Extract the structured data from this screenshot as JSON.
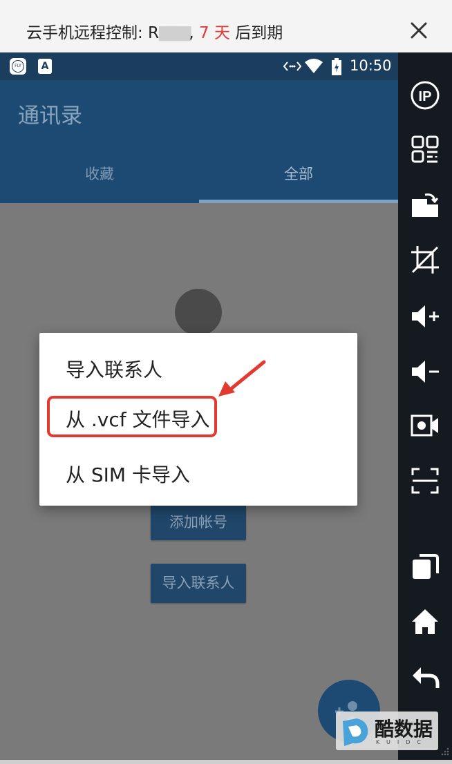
{
  "banner": {
    "prefix": "云手机远程控制: R",
    "masked_device": "████",
    "comma": ", ",
    "days": "7 天",
    "suffix": " 后到期"
  },
  "statusbar": {
    "time": "10:50",
    "icons": [
      "iflytek-icon",
      "font-a-icon",
      "data-arrows-icon",
      "wifi-icon",
      "battery-icon"
    ]
  },
  "app": {
    "title": "通讯录",
    "tabs": [
      {
        "label": "收藏",
        "selected": false
      },
      {
        "label": "全部",
        "selected": true
      }
    ],
    "buttons": {
      "add_account": "添加帐号",
      "import_contacts": "导入联系人"
    }
  },
  "dialog": {
    "title": "导入联系人",
    "items": [
      {
        "label": "从 .vcf 文件导入",
        "highlighted": true
      },
      {
        "label": "从 SIM 卡导入",
        "highlighted": false
      }
    ]
  },
  "rail": {
    "buttons": [
      "ip-icon",
      "qr-code-icon",
      "screen-rotate-icon",
      "crop-icon",
      "volume-up-icon",
      "volume-down-icon",
      "video-record-icon",
      "screenshot-icon",
      "recent-apps-icon",
      "home-icon",
      "back-icon"
    ]
  },
  "watermark": {
    "text": "酷数据",
    "sub": "KUIDC"
  },
  "colors": {
    "highlight": "#e23a2f",
    "appbar": "#1d4a72",
    "statusbar": "#1b3e5f",
    "banner_days": "#e53935"
  }
}
